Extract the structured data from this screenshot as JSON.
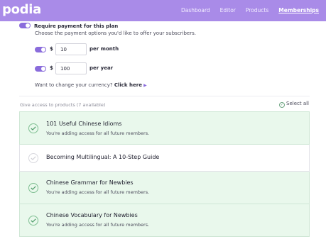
{
  "header": {
    "logo": "podia",
    "nav": [
      {
        "label": "Dashboard",
        "active": false
      },
      {
        "label": "Editor",
        "active": false
      },
      {
        "label": "Products",
        "active": false
      },
      {
        "label": "Memberships",
        "active": true
      }
    ]
  },
  "payment": {
    "require_label": "Require payment for this plan",
    "require_enabled": true,
    "description": "Choose the payment options you'd like to offer your subscribers.",
    "options": [
      {
        "enabled": true,
        "currency_symbol": "$",
        "amount": "10",
        "period": "per month"
      },
      {
        "enabled": true,
        "currency_symbol": "$",
        "amount": "100",
        "period": "per year"
      }
    ],
    "currency_prompt": "Want to change your currency?",
    "currency_link": "Click here"
  },
  "products": {
    "heading": "Give access to products (7 available)",
    "select_all": "Select all",
    "items": [
      {
        "title": "101 Useful Chinese Idioms",
        "subtitle": "You're adding access for all future members.",
        "selected": true
      },
      {
        "title": "Becoming Multilingual: A 10-Step Guide",
        "subtitle": "",
        "selected": false
      },
      {
        "title": "Chinese Grammar for Newbies",
        "subtitle": "You're adding access for all future members.",
        "selected": true
      },
      {
        "title": "Chinese Vocabulary for Newbies",
        "subtitle": "You're adding access for all future members.",
        "selected": true
      }
    ]
  },
  "colors": {
    "brand": "#a98be8",
    "toggle_on": "#8a6cdc",
    "selected_row": "#e9f8ec",
    "check_green": "#4e9c6a"
  }
}
